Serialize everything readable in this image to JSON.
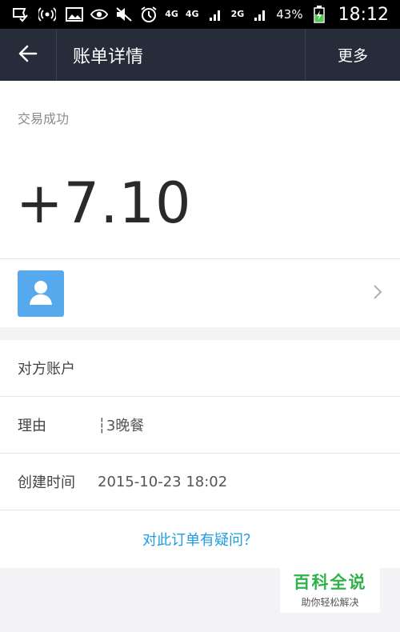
{
  "status_bar": {
    "network_1": "4G",
    "network_2": "4G",
    "network_3": "2G",
    "battery": "43%",
    "time": "18:12",
    "icons": [
      "notification-icon",
      "wifi-icon",
      "image-icon",
      "eye-icon",
      "mute-icon",
      "alarm-icon",
      "signal-icon",
      "battery-icon"
    ]
  },
  "nav": {
    "title": "账单详情",
    "more_label": "更多",
    "back_icon": "arrow-left-icon"
  },
  "summary": {
    "status": "交易成功",
    "amount": "+7.10"
  },
  "counterparty": {
    "name": "",
    "avatar_icon": "person-icon",
    "avatar_color": "#55a9ec"
  },
  "details": {
    "rows": [
      {
        "label": "对方账户",
        "value": ""
      },
      {
        "label": "理由",
        "value": "┆3晚餐"
      },
      {
        "label": "创建时间",
        "value": "2015-10-23 18:02"
      }
    ],
    "question_link": "对此订单有疑问？"
  },
  "watermark": {
    "title": "百科全说",
    "subtitle": "助你轻松解决"
  },
  "colors": {
    "nav_bg": "#262c3a",
    "link": "#1e9ce0",
    "watermark_green": "#2fb24a"
  }
}
